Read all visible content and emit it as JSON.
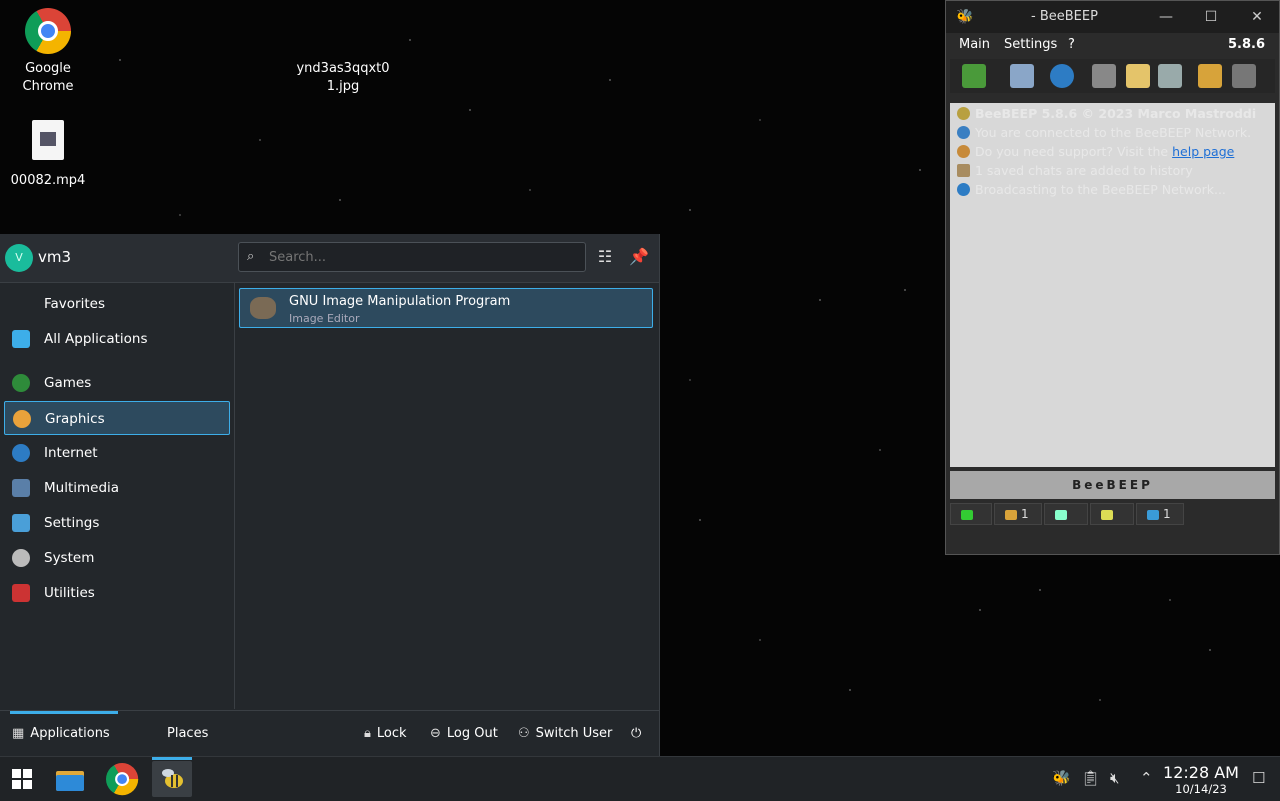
{
  "desktop": {
    "icons": [
      {
        "label": "Google\nChrome",
        "line1": "Google",
        "line2": "Chrome"
      },
      {
        "label": "ynd3as3qqxt01.jpg",
        "line1": "ynd3as3qqxt0",
        "line2": "1.jpg"
      },
      {
        "label": "00082.mp4",
        "line1": "00082.mp4"
      }
    ]
  },
  "launcher": {
    "user_initial": "V",
    "username": "vm3",
    "search_placeholder": "Search...",
    "categories": [
      {
        "label": "Favorites"
      },
      {
        "label": "All Applications"
      },
      {
        "label": "Games"
      },
      {
        "label": "Graphics"
      },
      {
        "label": "Internet"
      },
      {
        "label": "Multimedia"
      },
      {
        "label": "Settings"
      },
      {
        "label": "System"
      },
      {
        "label": "Utilities"
      }
    ],
    "results": [
      {
        "title": "GNU Image Manipulation Program",
        "subtitle": "Image Editor"
      }
    ],
    "footer": {
      "applications": "Applications",
      "places": "Places",
      "lock": "Lock",
      "logout": "Log Out",
      "switch_user": "Switch User"
    }
  },
  "beebeep": {
    "title": "- BeeBEEP",
    "menu": [
      "Main",
      "Settings",
      "?"
    ],
    "version": "5.8.6",
    "log": [
      "BeeBEEP 5.8.6 © 2023 Marco Mastroddi",
      "You are connected to the BeeBEEP Network.",
      "Do you need support? Visit the",
      "help page",
      "1 saved chats are added to history",
      "Broadcasting to the BeeBEEP Network..."
    ],
    "brand": "BeeBEEP",
    "status": {
      "users_count": "1",
      "network_count": "1"
    }
  },
  "taskbar": {
    "time": "12:28 AM",
    "date": "10/14/23"
  },
  "colors": {
    "accent": "#3daee9",
    "panel": "#23272b",
    "taskbar": "#202326"
  }
}
